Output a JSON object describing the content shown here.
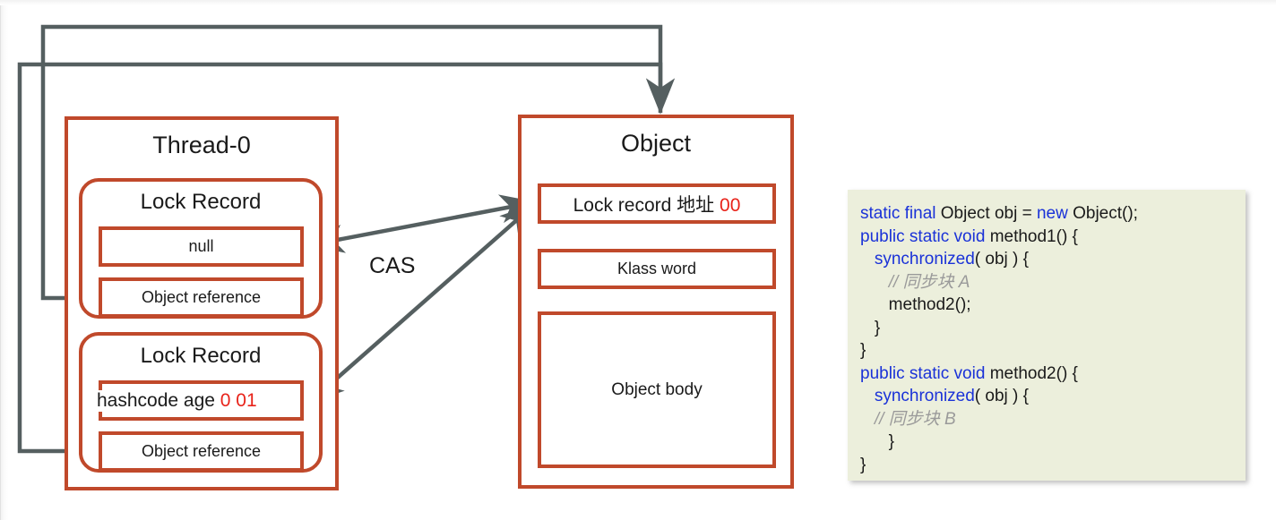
{
  "diagram": {
    "title_thread": "Thread-0",
    "title_object": "Object",
    "cas_label": "CAS",
    "lock_records": [
      {
        "title": "Lock Record",
        "mark_word": "null",
        "mark_word_red": "",
        "object_reference": "Object reference"
      },
      {
        "title": "Lock Record",
        "mark_word": "hashcode age ",
        "mark_word_red": "0 01",
        "object_reference": "Object reference"
      }
    ],
    "object_fields": [
      {
        "label": "Lock record ",
        "label_cjk": "地址 ",
        "value_red": "00"
      },
      {
        "label": "Klass word"
      },
      {
        "label": "Object body"
      }
    ]
  },
  "code": {
    "lines": [
      [
        {
          "t": "static final ",
          "c": "kw"
        },
        {
          "t": "Object obj = ",
          "c": ""
        },
        {
          "t": "new ",
          "c": "kw"
        },
        {
          "t": "Object();",
          "c": ""
        }
      ],
      [
        {
          "t": "public static void ",
          "c": "kw"
        },
        {
          "t": "method1() {",
          "c": ""
        }
      ],
      [
        {
          "t": "   ",
          "c": ""
        },
        {
          "t": "synchronized",
          "c": "kw"
        },
        {
          "t": "( obj ) {",
          "c": ""
        }
      ],
      [
        {
          "t": "      ",
          "c": ""
        },
        {
          "t": "// 同步块 A",
          "c": "cmt"
        }
      ],
      [
        {
          "t": "      method2();",
          "c": ""
        }
      ],
      [
        {
          "t": "   }",
          "c": ""
        }
      ],
      [
        {
          "t": "}",
          "c": ""
        }
      ],
      [
        {
          "t": "public static void ",
          "c": "kw"
        },
        {
          "t": "method2() {",
          "c": ""
        }
      ],
      [
        {
          "t": "   ",
          "c": ""
        },
        {
          "t": "synchronized",
          "c": "kw"
        },
        {
          "t": "( obj ) {",
          "c": ""
        }
      ],
      [
        {
          "t": "   ",
          "c": ""
        },
        {
          "t": "// 同步块 B",
          "c": "cmt"
        }
      ],
      [
        {
          "t": "      }",
          "c": ""
        }
      ],
      [
        {
          "t": "}",
          "c": ""
        }
      ]
    ]
  },
  "colors": {
    "box_border": "#C0492B",
    "wire": "#555f60",
    "accent_red": "#e8231a",
    "keyword_blue": "#1a32d8",
    "code_bg": "#ECEFDC"
  }
}
